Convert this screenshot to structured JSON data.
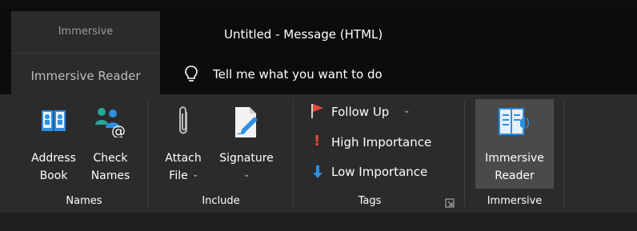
{
  "title_bar": {
    "contextual_group": "Immersive",
    "contextual_tab": "Immersive Reader",
    "window_title": "Untitled  -  Message (HTML)",
    "tell_me": "Tell me what you want to do"
  },
  "ribbon": {
    "groups": {
      "names": {
        "label": "Names",
        "address_book": [
          "Address",
          "Book"
        ],
        "check_names": [
          "Check",
          "Names"
        ]
      },
      "include": {
        "label": "Include",
        "attach_file": [
          "Attach",
          "File"
        ],
        "signature": "Signature"
      },
      "tags": {
        "label": "Tags",
        "follow_up": "Follow Up",
        "high_importance": "High Importance",
        "low_importance": "Low Importance"
      },
      "immersive": {
        "label": "Immersive",
        "immersive_reader": [
          "Immersive",
          "Reader"
        ]
      }
    },
    "colors": {
      "accent_blue": "#2f8fe0",
      "flag_red": "#e04a3a",
      "importance_red": "#e74c3c",
      "teal": "#26a69a"
    }
  }
}
